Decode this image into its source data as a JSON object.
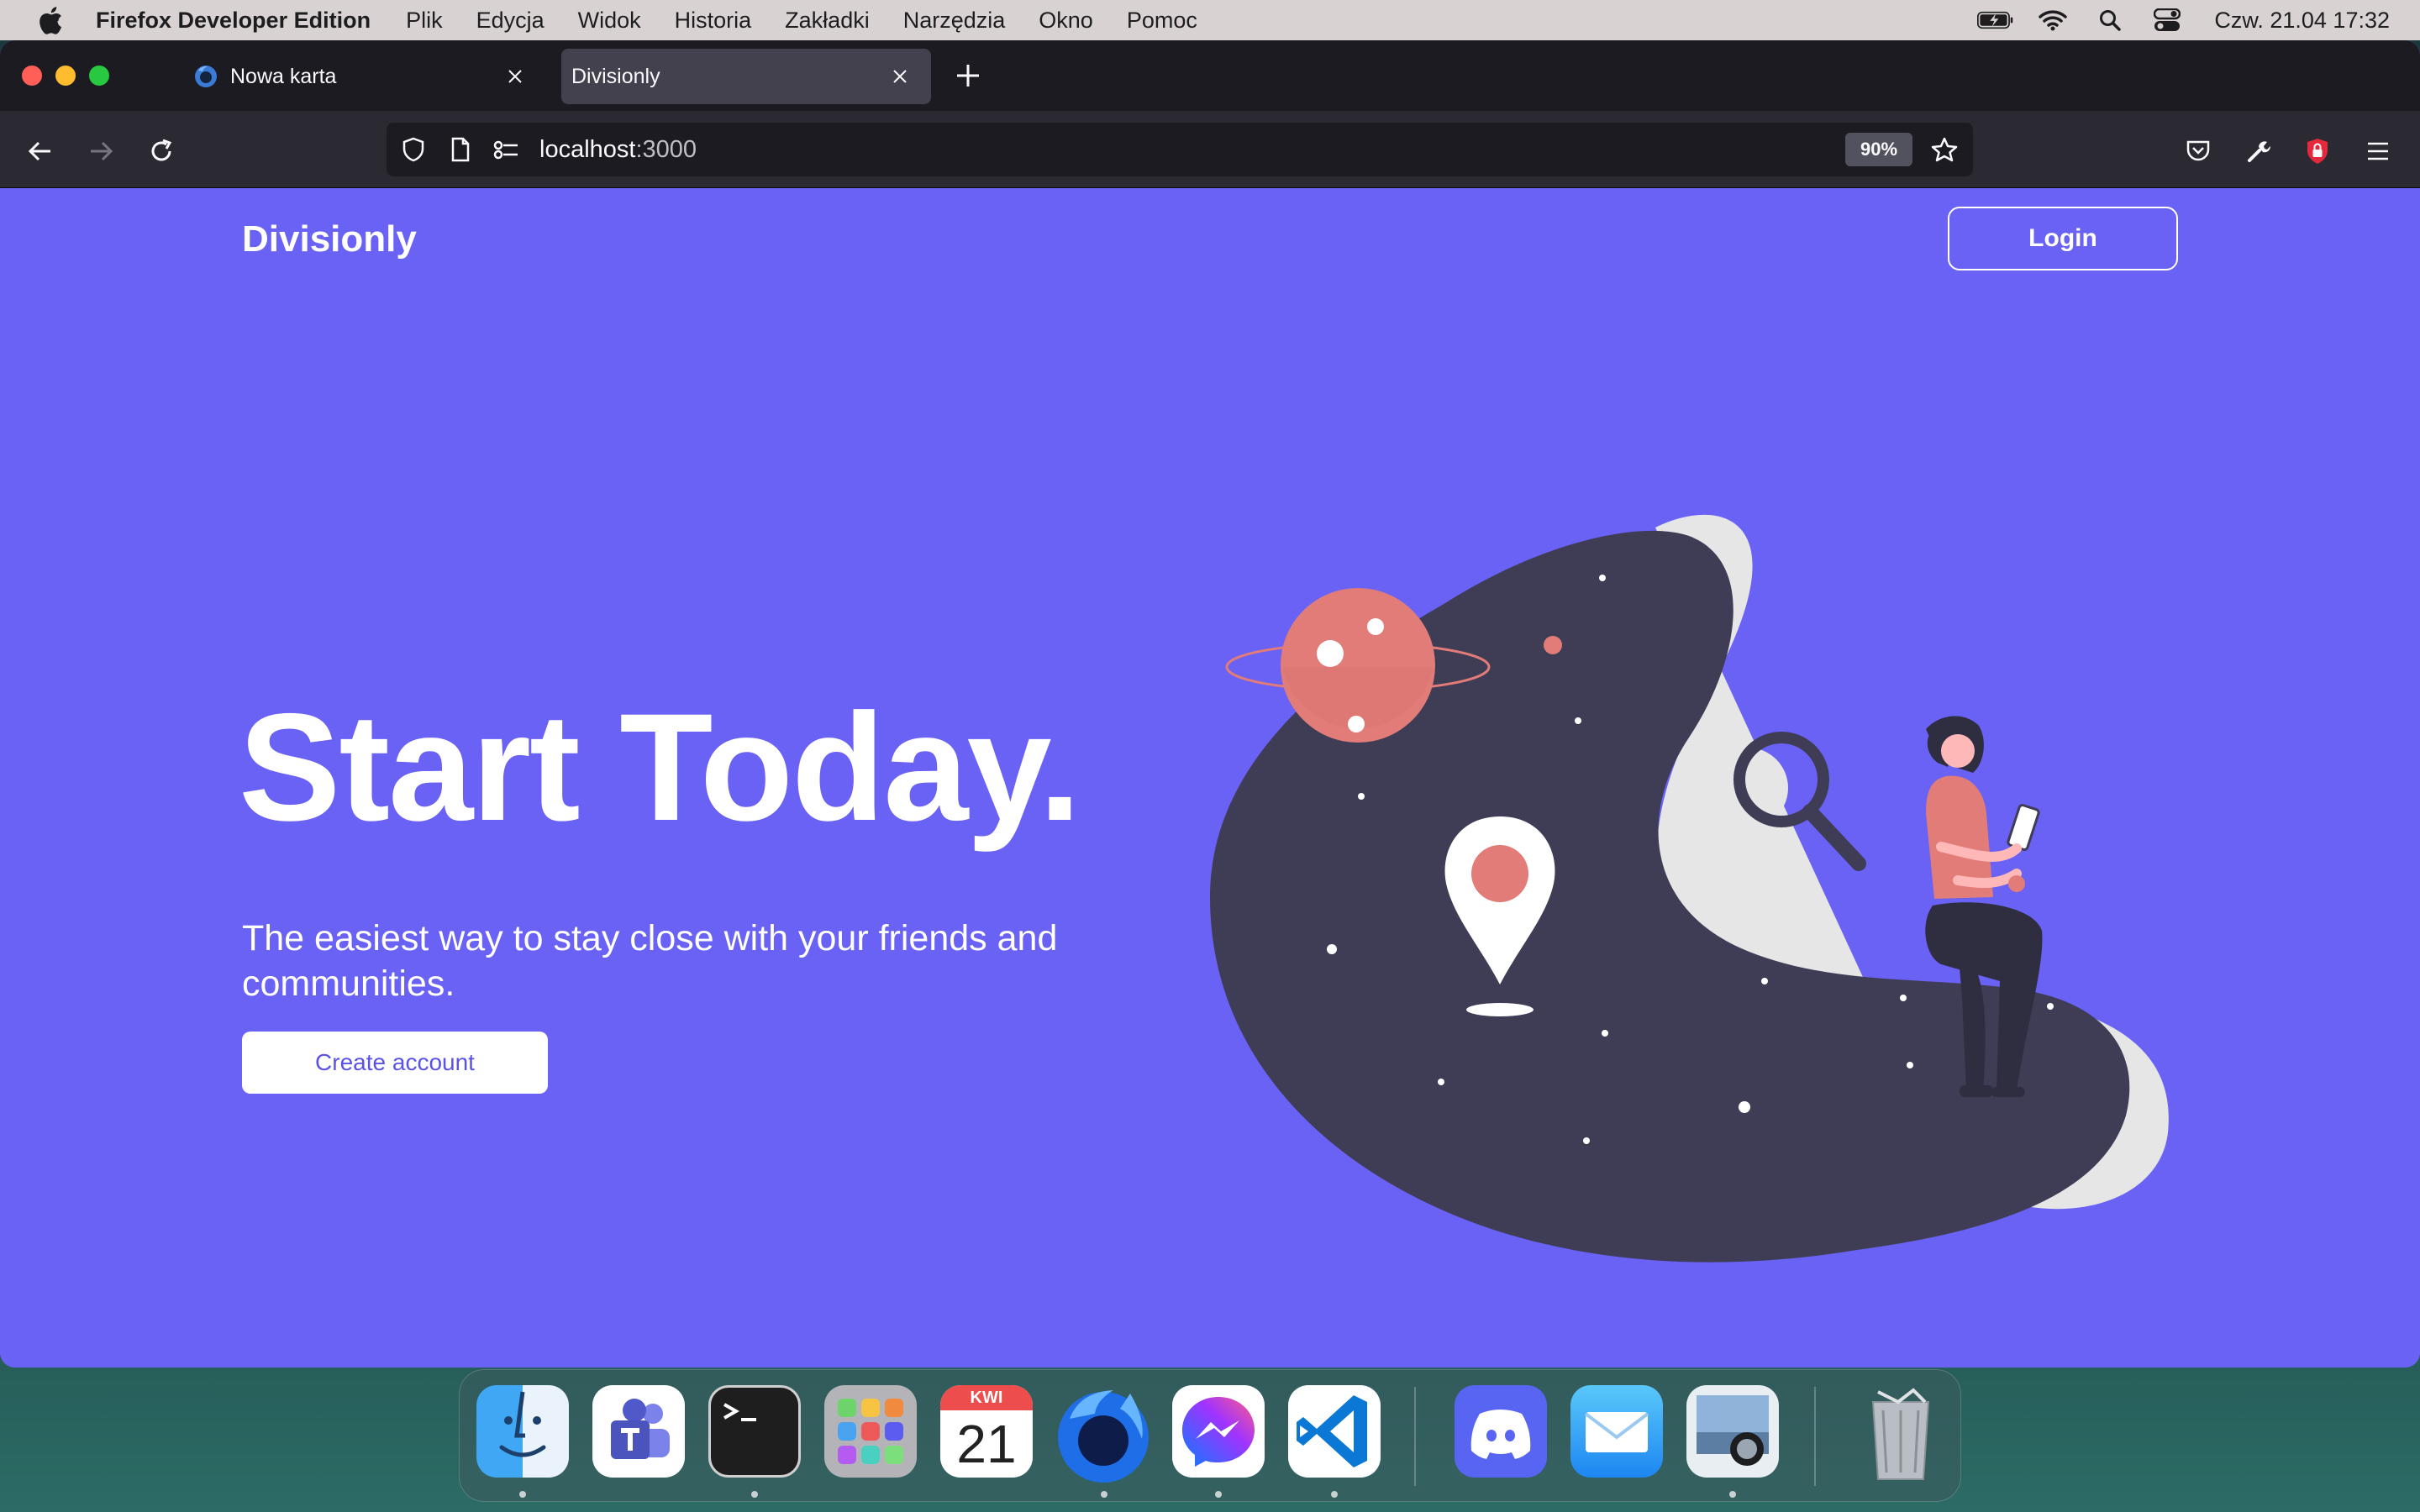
{
  "menubar": {
    "app_name": "Firefox Developer Edition",
    "items": [
      "Plik",
      "Edycja",
      "Widok",
      "Historia",
      "Zakładki",
      "Narzędzia",
      "Okno",
      "Pomoc"
    ],
    "clock": "Czw. 21.04  17:32"
  },
  "browser": {
    "tabs": [
      {
        "title": "Nowa karta",
        "active": false
      },
      {
        "title": "Divisionly",
        "active": true
      }
    ],
    "url_host": "localhost",
    "url_port": ":3000",
    "zoom": "90%"
  },
  "page": {
    "brand": "Divisionly",
    "login_label": "Login",
    "hero_title": "Start Today.",
    "hero_subtitle": "The easiest way to stay close with your friends and communities.",
    "cta_label": "Create account"
  },
  "dock": {
    "calendar_month": "KWI",
    "calendar_day": "21",
    "apps": [
      "finder-icon",
      "teams-icon",
      "terminal-icon",
      "launchpad-icon",
      "calendar-icon",
      "firefox-dev-icon",
      "messenger-icon",
      "vscode-icon",
      "discord-icon",
      "mail-icon",
      "preview-icon",
      "trash-icon"
    ]
  },
  "colors": {
    "page_bg": "#6a62f4",
    "blob": "#3f3d56",
    "accent_coral": "#e27c78",
    "cta_text": "#5b53e8"
  }
}
